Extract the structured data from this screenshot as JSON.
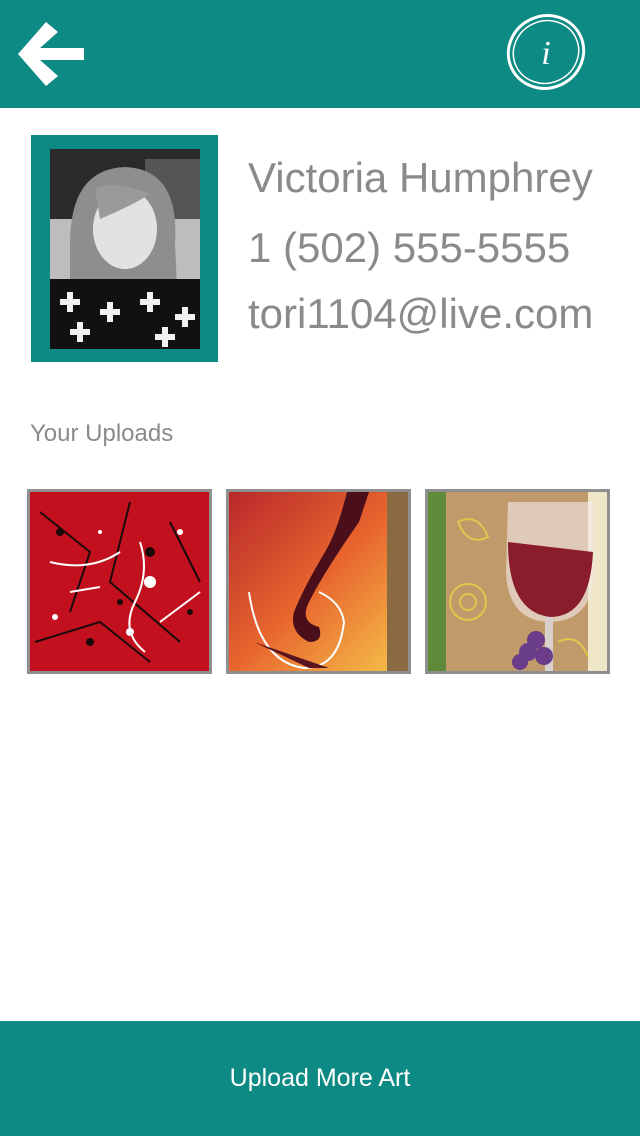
{
  "header": {
    "back_icon": "arrow-left-icon",
    "logo_icon": "info-logo-icon",
    "logo_letter": "i"
  },
  "profile": {
    "name": "Victoria Humphrey",
    "phone": "1 (502) 555-5555",
    "email": "tori1104@live.com"
  },
  "uploads": {
    "label": "Your Uploads",
    "items": [
      {
        "name": "red splatter painting"
      },
      {
        "name": "wine pour painting"
      },
      {
        "name": "wine glass with grapes painting"
      }
    ]
  },
  "footer": {
    "upload_label": "Upload More Art"
  },
  "colors": {
    "brand_teal": "#0e8a84",
    "text_gray": "#8a8a8a"
  }
}
